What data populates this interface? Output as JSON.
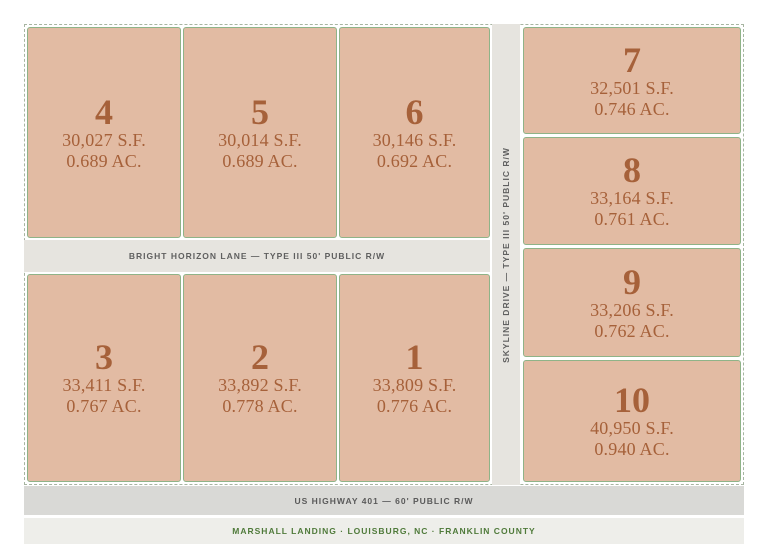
{
  "lots": [
    {
      "number": "4",
      "sf": "30,027 S.F.",
      "ac": "0.689 AC."
    },
    {
      "number": "5",
      "sf": "30,014 S.F.",
      "ac": "0.689 AC."
    },
    {
      "number": "6",
      "sf": "30,146 S.F.",
      "ac": "0.692 AC."
    },
    {
      "number": "3",
      "sf": "33,411 S.F.",
      "ac": "0.767 AC."
    },
    {
      "number": "2",
      "sf": "33,892 S.F.",
      "ac": "0.778 AC."
    },
    {
      "number": "1",
      "sf": "33,809 S.F.",
      "ac": "0.776 AC."
    },
    {
      "number": "7",
      "sf": "32,501 S.F.",
      "ac": "0.746 AC."
    },
    {
      "number": "8",
      "sf": "33,164 S.F.",
      "ac": "0.761 AC."
    },
    {
      "number": "9",
      "sf": "33,206 S.F.",
      "ac": "0.762 AC."
    },
    {
      "number": "10",
      "sf": "40,950 S.F.",
      "ac": "0.940 AC."
    }
  ],
  "roads": {
    "lane": "BRIGHT HORIZON LANE — TYPE III 50' PUBLIC R/W",
    "drive": "SKYLINE DRIVE — TYPE III 50' PUBLIC R/W",
    "highway": "US HIGHWAY 401 — 60' PUBLIC R/W"
  },
  "footer": {
    "caption": "MARSHALL LANDING · LOUISBURG, NC · FRANKLIN COUNTY"
  },
  "colors": {
    "lot_fill": "#e2bba3",
    "lot_border": "#8fb388",
    "lot_text": "#a6613a",
    "road": "#e6e4df",
    "footer_text": "#4f7a3a"
  }
}
